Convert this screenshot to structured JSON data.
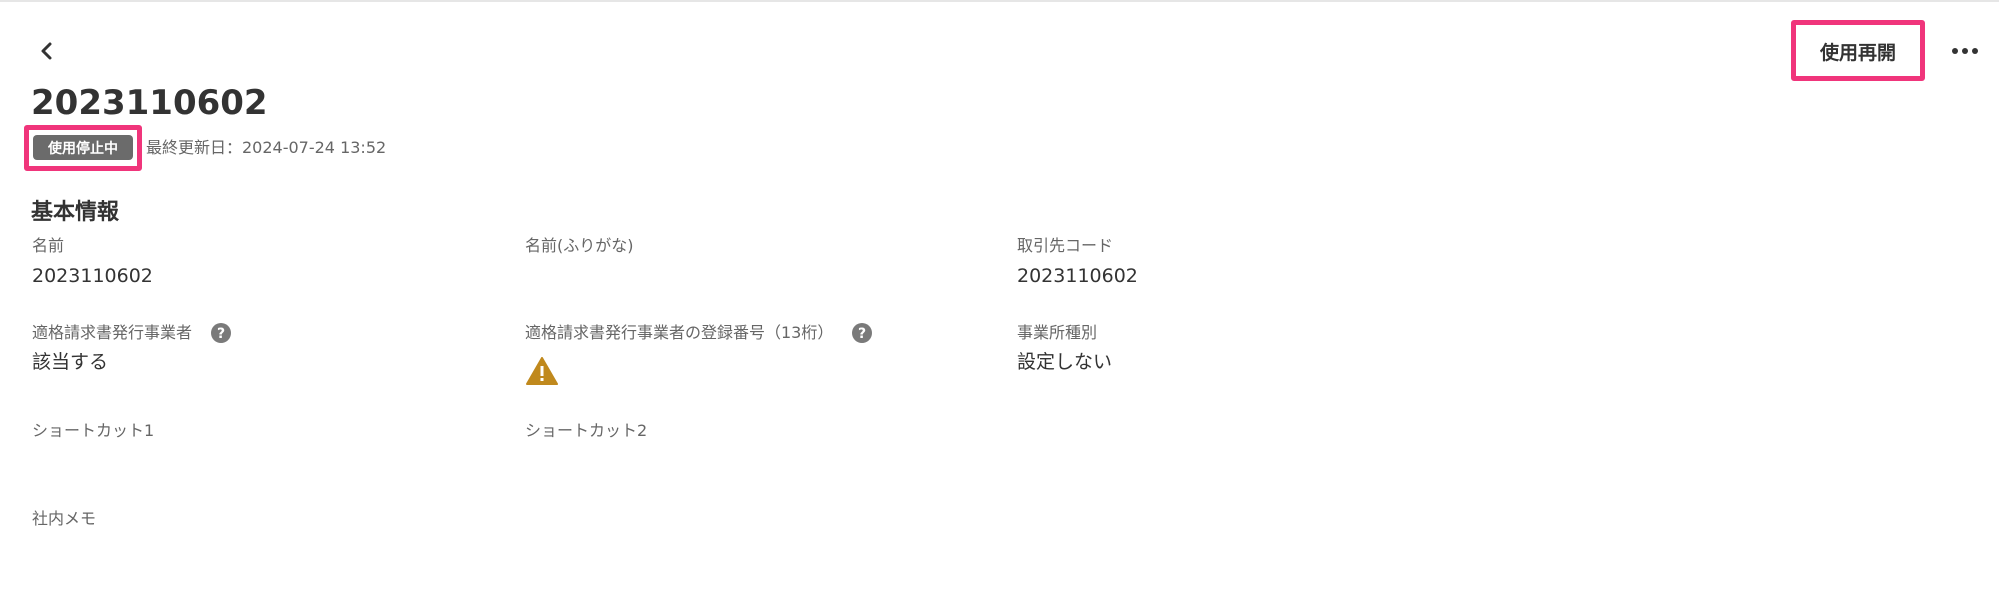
{
  "header": {
    "back_icon": "chevron-left-icon",
    "resume_label": "使用再開",
    "more_icon": "more-horizontal-icon",
    "highlight_color": "#f0357b"
  },
  "record": {
    "title": "2023110602",
    "status_badge": "使用停止中",
    "updated_label": "最終更新日：2024-07-24 13:52"
  },
  "basic_info": {
    "section_title": "基本情報",
    "fields": [
      {
        "label": "名前",
        "value": "2023110602"
      },
      {
        "label": "名前(ふりがな)",
        "value": ""
      },
      {
        "label": "取引先コード",
        "value": "2023110602"
      },
      {
        "label": "適格請求書発行事業者",
        "value": "該当する",
        "icon": "help-icon"
      },
      {
        "label": "適格請求書発行事業者の登録番号（13桁）",
        "value": "",
        "icon": "help-icon",
        "value_icon": "warning-icon",
        "warning_color": "#c0891d"
      },
      {
        "label": "事業所種別",
        "value": "設定しない"
      },
      {
        "label": "ショートカット1",
        "value": ""
      },
      {
        "label": "ショートカット2",
        "value": ""
      },
      {
        "label": "社内メモ",
        "value": ""
      }
    ]
  }
}
